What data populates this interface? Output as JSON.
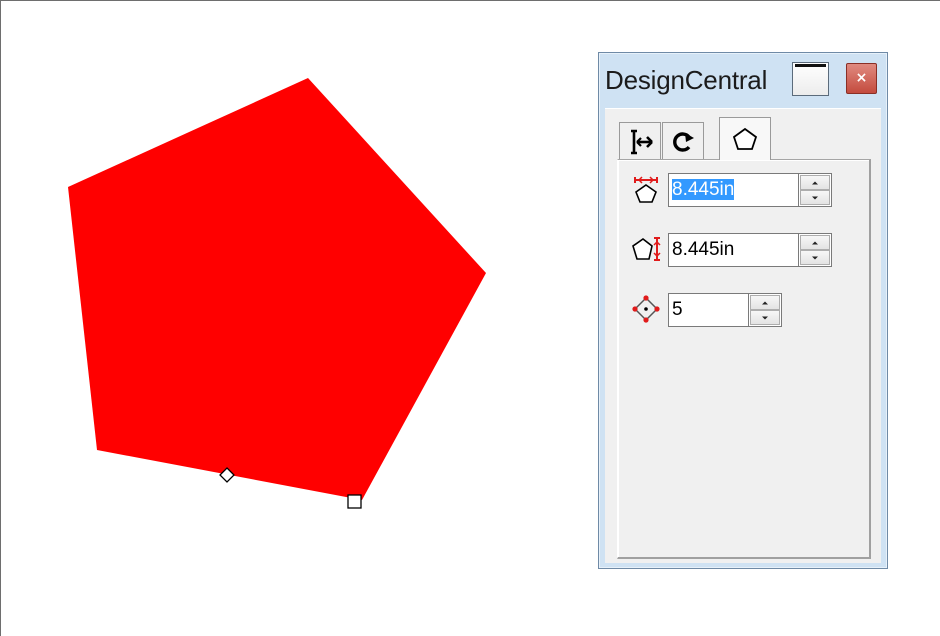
{
  "window": {
    "title": "DesignCentral",
    "close_label": "×",
    "close_color": "#c44b3e",
    "frame_color": "#cfe2f3"
  },
  "canvas": {
    "shape": {
      "type": "regular-polygon",
      "sides": 5,
      "fill_color": "#ff0000",
      "handles": [
        "diamond-handle",
        "square-handle"
      ]
    }
  },
  "tabs": [
    {
      "name": "move-size-tab",
      "icon": "move-arrows-icon",
      "active": false
    },
    {
      "name": "rotate-tab",
      "icon": "rotate-arrow-icon",
      "active": false
    },
    {
      "name": "polygon-tab",
      "icon": "pentagon-icon",
      "active": true
    }
  ],
  "polygon_tab": {
    "width_field": {
      "icon": "polygon-width-icon",
      "value": "8.445in",
      "selected": true
    },
    "height_field": {
      "icon": "polygon-height-icon",
      "value": "8.445in"
    },
    "sides_field": {
      "icon": "polygon-sides-icon",
      "value": "5"
    }
  },
  "colors": {
    "accent_red": "#e01b1b",
    "selection_blue": "#3399ff"
  }
}
